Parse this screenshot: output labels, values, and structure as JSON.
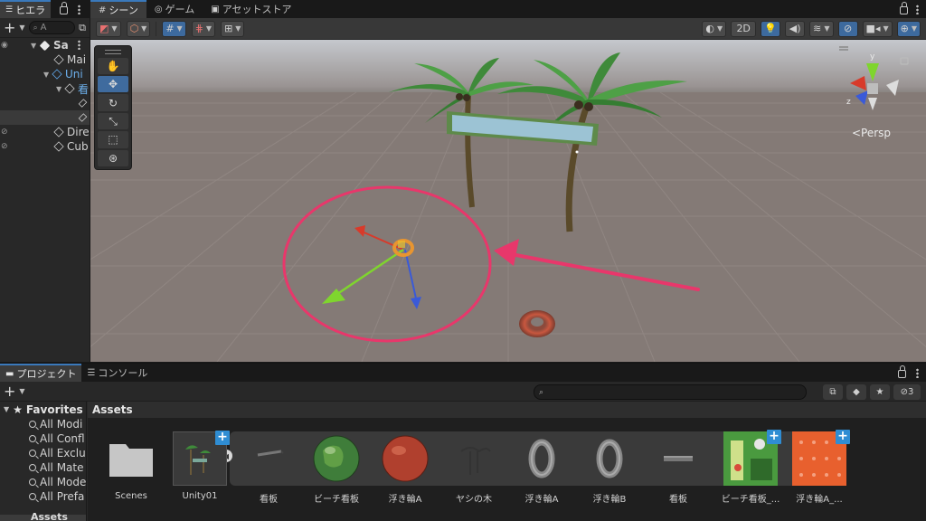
{
  "hierarchy": {
    "tab_label": "ヒエラ",
    "search_placeholder": "A",
    "rows": [
      {
        "label": "Sa"
      },
      {
        "label": "Mai"
      },
      {
        "label": "Uni"
      },
      {
        "label": "看"
      },
      {
        "label": ""
      },
      {
        "label": ""
      },
      {
        "label": "Dire"
      },
      {
        "label": "Cub"
      }
    ]
  },
  "scene": {
    "tabs": [
      {
        "label": "シーン",
        "icon": "grid-icon"
      },
      {
        "label": "ゲーム",
        "icon": "gamepad-icon"
      },
      {
        "label": "アセットストア",
        "icon": "store-icon"
      }
    ],
    "toolbar": {
      "mode_2d": "2D"
    },
    "persp_label": "<Persp",
    "gizmo_axes": {
      "y": "y",
      "z": "z"
    },
    "sign_color": "#9cc3d4",
    "highlight_color": "#e8376b"
  },
  "project": {
    "tabs": [
      {
        "label": "プロジェクト"
      },
      {
        "label": "コンソール"
      }
    ],
    "search_placeholder": "",
    "hidden_count": "3",
    "favorites": {
      "title": "Favorites",
      "items": [
        "All Modi",
        "All Confl",
        "All Exclu",
        "All Mate",
        "All Mode",
        "All Prefa"
      ]
    },
    "assets_title": "Assets",
    "bottom_label": "Assets",
    "assets": [
      {
        "label": "Scenes",
        "kind": "folder"
      },
      {
        "label": "Unity01",
        "kind": "prefab"
      },
      {
        "label": "看板",
        "kind": "mesh"
      },
      {
        "label": "ビーチ看板",
        "kind": "material-green"
      },
      {
        "label": "浮き輪A",
        "kind": "material-red"
      },
      {
        "label": "ヤシの木",
        "kind": "tree"
      },
      {
        "label": "浮き輪A",
        "kind": "ring"
      },
      {
        "label": "浮き輪B",
        "kind": "ring"
      },
      {
        "label": "看板",
        "kind": "bar"
      },
      {
        "label": "ビーチ看板_...",
        "kind": "texture-green"
      },
      {
        "label": "浮き輪A_...",
        "kind": "texture-red"
      }
    ]
  }
}
